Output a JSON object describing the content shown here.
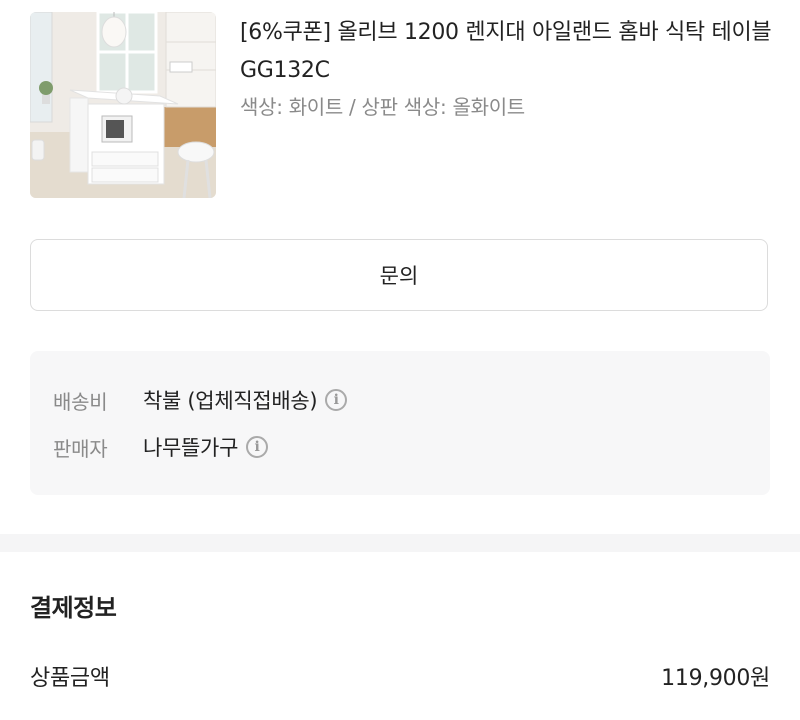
{
  "product": {
    "title": "[6%쿠폰] 올리브 1200 렌지대 아일랜드 홈바 식탁 테이블 GG132C",
    "option": "색상: 화이트 / 상판 색상: 올화이트",
    "image_icon": "product-photo"
  },
  "inquiry": {
    "label": "문의"
  },
  "delivery_info": {
    "rows": [
      {
        "label": "배송비",
        "value": "착불 (업체직접배송)",
        "icon": "info-icon"
      },
      {
        "label": "판매자",
        "value": "나무뜰가구",
        "icon": "info-icon"
      }
    ]
  },
  "payment": {
    "section_title": "결제정보",
    "rows": [
      {
        "label": "상품금액",
        "value": "119,900원"
      }
    ]
  },
  "colors": {
    "info_bg": "#f7f7f8",
    "border": "#dcdcdc",
    "muted_text": "#8a8a8a",
    "text": "#222222"
  }
}
